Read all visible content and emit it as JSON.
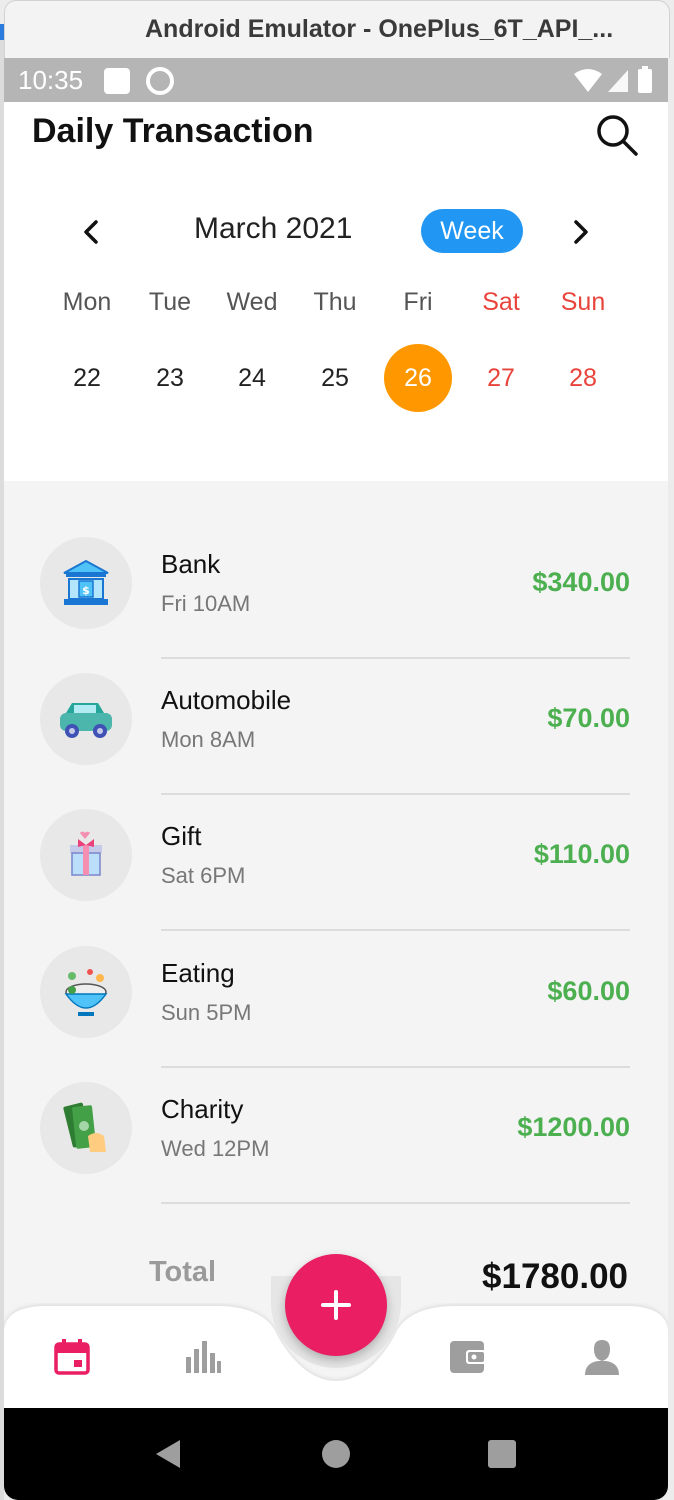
{
  "window": {
    "title": "Android Emulator - OnePlus_6T_API_..."
  },
  "status_bar": {
    "time": "10:35"
  },
  "header": {
    "title": "Daily Transaction",
    "search_icon": "search-icon"
  },
  "calendar": {
    "month_label": "March 2021",
    "view_mode": "Week",
    "days": [
      {
        "name": "Mon",
        "date": "22",
        "weekend": false,
        "selected": false
      },
      {
        "name": "Tue",
        "date": "23",
        "weekend": false,
        "selected": false
      },
      {
        "name": "Wed",
        "date": "24",
        "weekend": false,
        "selected": false
      },
      {
        "name": "Thu",
        "date": "25",
        "weekend": false,
        "selected": false
      },
      {
        "name": "Fri",
        "date": "26",
        "weekend": false,
        "selected": true
      },
      {
        "name": "Sat",
        "date": "27",
        "weekend": true,
        "selected": false
      },
      {
        "name": "Sun",
        "date": "28",
        "weekend": true,
        "selected": false
      }
    ]
  },
  "transactions": [
    {
      "name": "Bank",
      "time": "Fri 10AM",
      "amount": "$340.00",
      "icon": "bank-icon"
    },
    {
      "name": "Automobile",
      "time": "Mon 8AM",
      "amount": "$70.00",
      "icon": "car-icon"
    },
    {
      "name": "Gift",
      "time": "Sat 6PM",
      "amount": "$110.00",
      "icon": "gift-icon"
    },
    {
      "name": "Eating",
      "time": "Sun 5PM",
      "amount": "$60.00",
      "icon": "food-bowl-icon"
    },
    {
      "name": "Charity",
      "time": "Wed 12PM",
      "amount": "$1200.00",
      "icon": "money-hand-icon"
    }
  ],
  "summary": {
    "total_label": "Total",
    "total_amount": "$1780.00"
  },
  "bottom_nav": {
    "items": [
      "calendar-icon",
      "bar-chart-icon",
      "wallet-icon",
      "profile-icon"
    ],
    "active": "calendar-icon",
    "fab_icon": "plus-icon"
  },
  "colors": {
    "accent_blue": "#2196f3",
    "selected_day": "#ff9800",
    "weekend": "#e8443c",
    "amount_green": "#4caf50",
    "fab_pink": "#e91e63"
  }
}
